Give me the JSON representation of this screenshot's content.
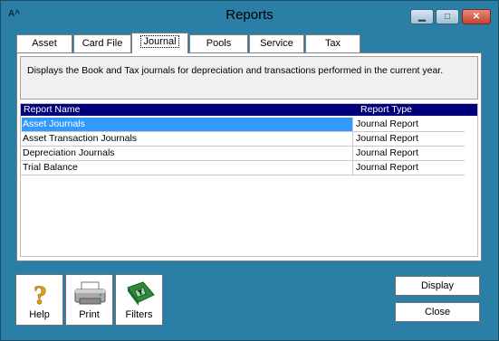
{
  "window": {
    "title": "Reports",
    "app_icon": "A^",
    "minimize_glyph": "▁",
    "maximize_glyph": "□",
    "close_glyph": "✕"
  },
  "tabs": [
    {
      "label": "Asset"
    },
    {
      "label": "Card File"
    },
    {
      "label": "Journal"
    },
    {
      "label": "Pools"
    },
    {
      "label": "Service"
    },
    {
      "label": "Tax"
    }
  ],
  "active_tab": "Journal",
  "description": "Displays the Book and Tax journals for depreciation and transactions performed in the current year.",
  "grid": {
    "columns": [
      "Report Name",
      "Report Type"
    ],
    "rows": [
      {
        "name": "Asset Journals",
        "type": "Journal Report",
        "selected": true
      },
      {
        "name": "Asset Transaction Journals",
        "type": "Journal Report",
        "selected": false
      },
      {
        "name": "Depreciation Journals",
        "type": "Journal Report",
        "selected": false
      },
      {
        "name": "Trial Balance",
        "type": "Journal Report",
        "selected": false
      }
    ]
  },
  "tools": [
    {
      "label": "Help",
      "icon": "question-icon"
    },
    {
      "label": "Print",
      "icon": "printer-icon"
    },
    {
      "label": "Filters",
      "icon": "filter-icon"
    }
  ],
  "buttons": {
    "display": "Display",
    "close": "Close"
  },
  "colors": {
    "frame": "#2b7fa6",
    "header": "#00007a",
    "selection": "#3399ff"
  }
}
